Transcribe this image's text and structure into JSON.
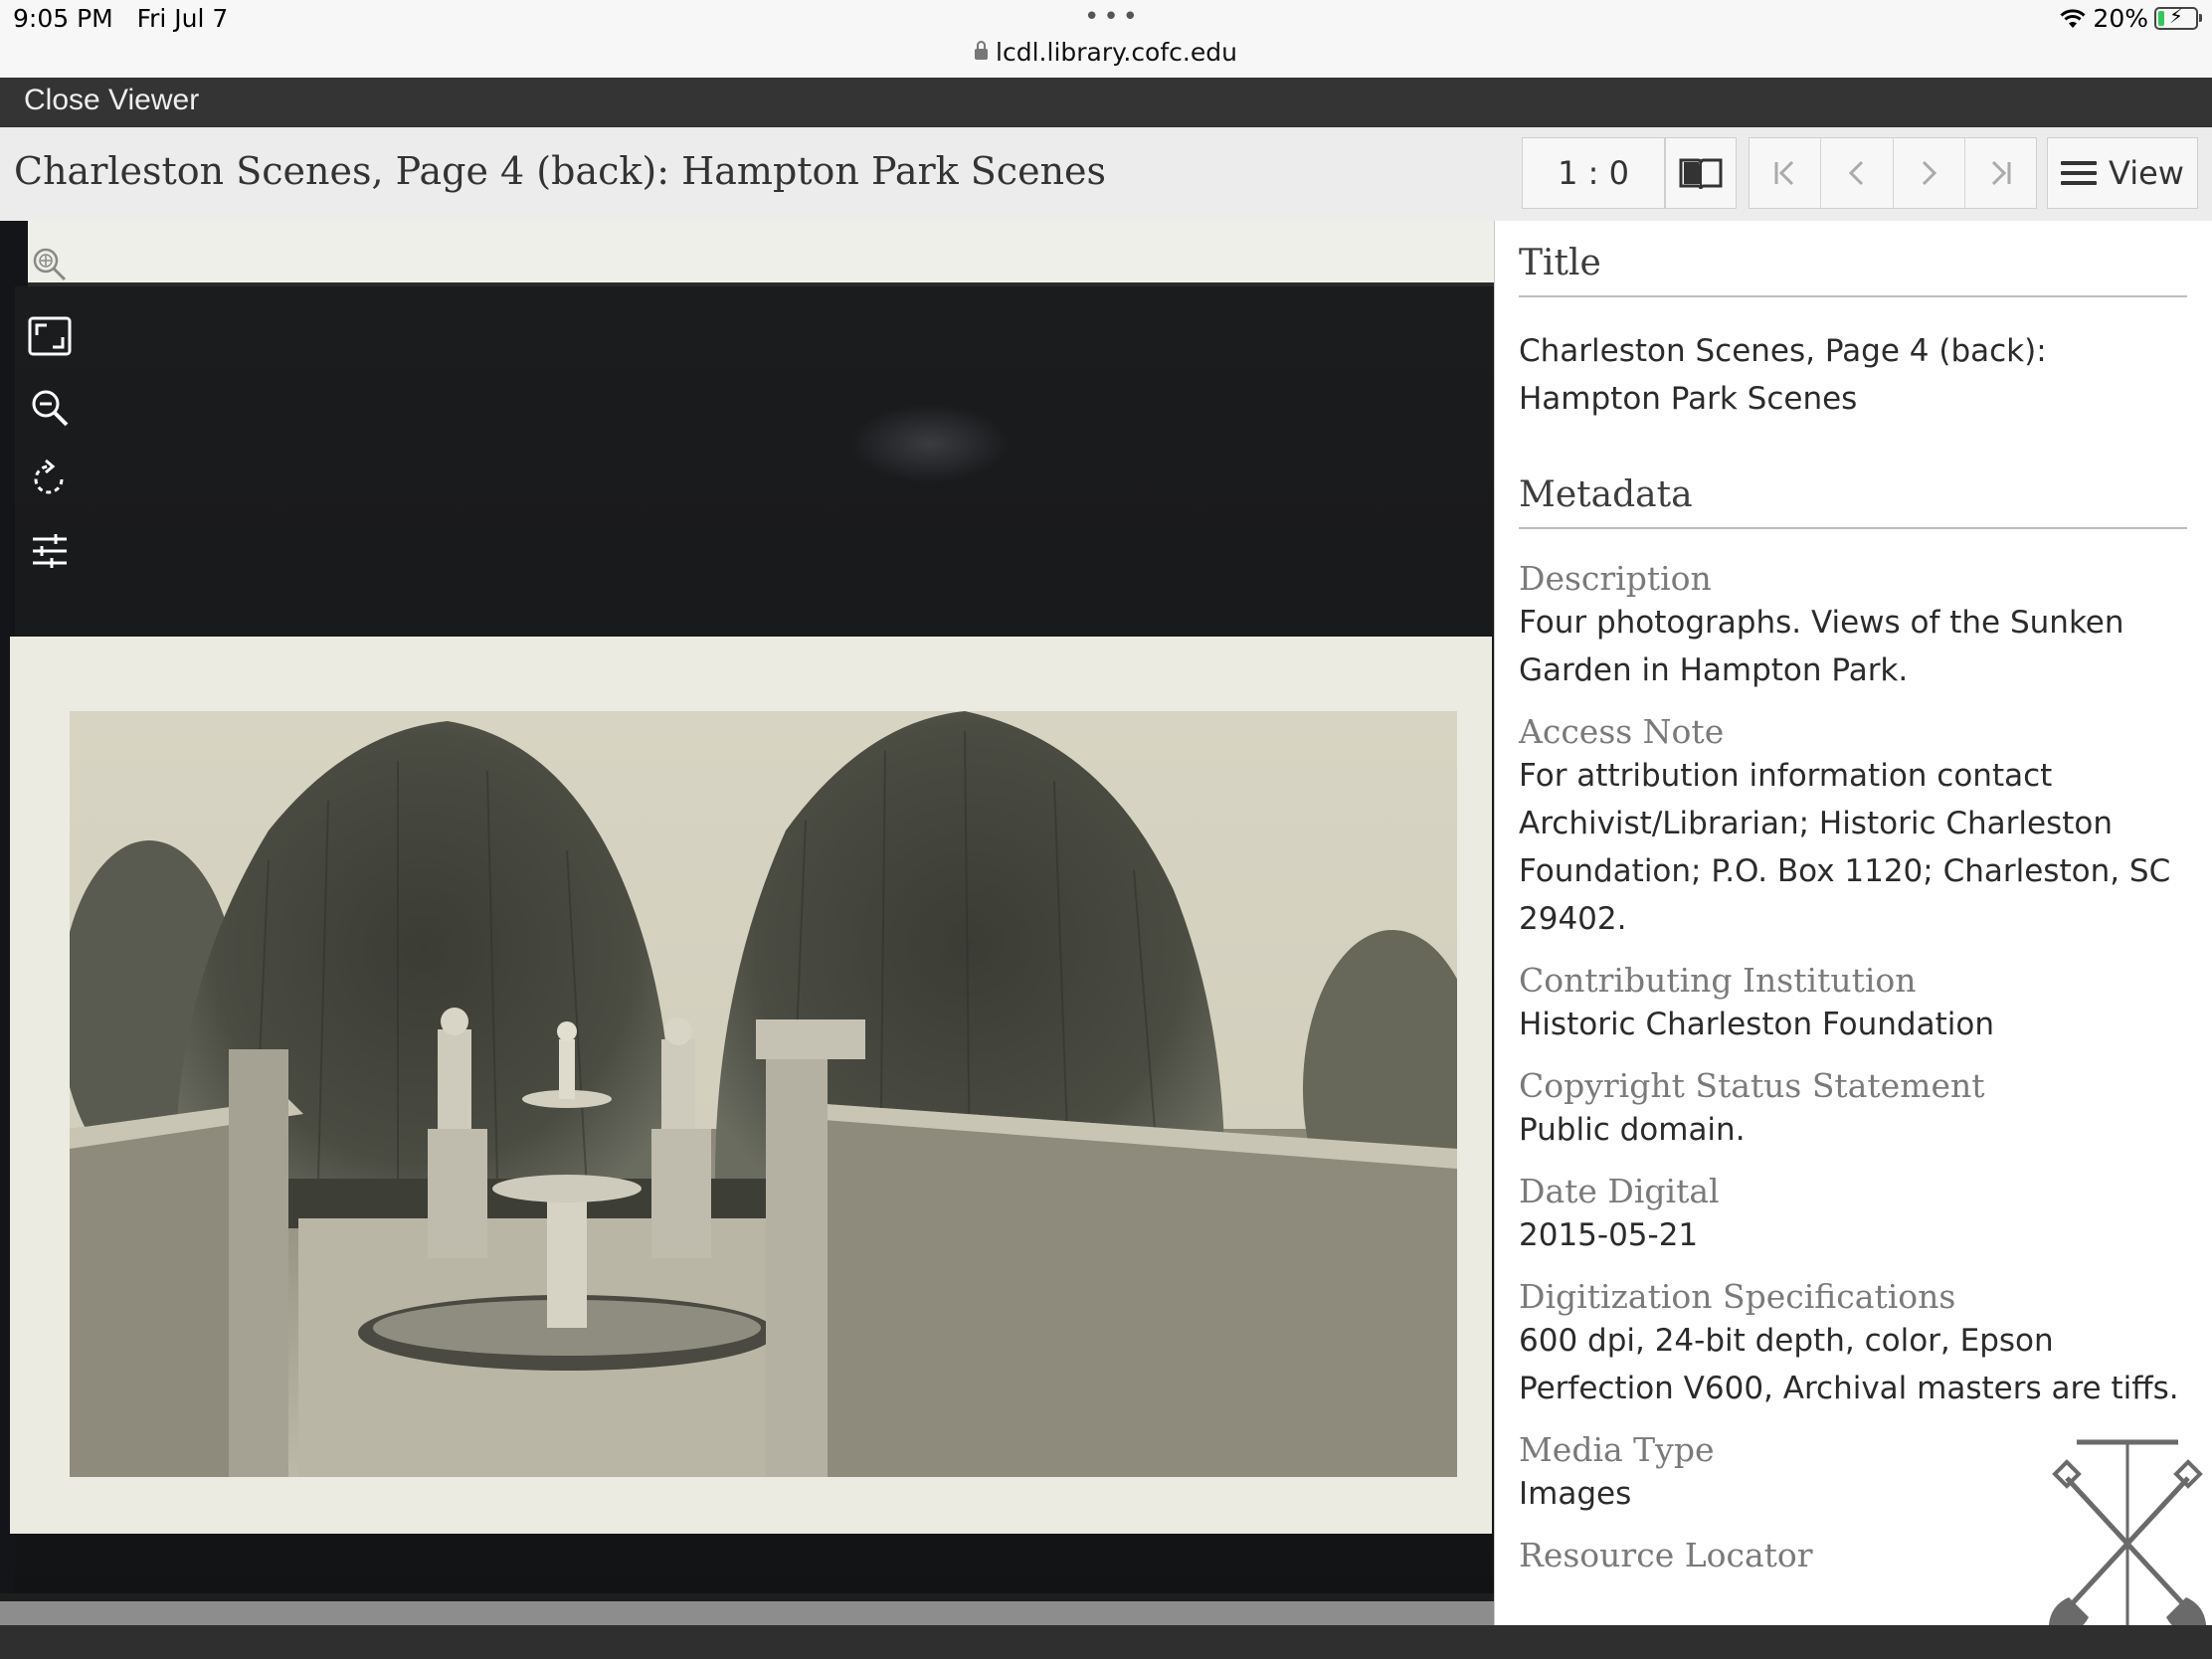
{
  "status_bar": {
    "time": "9:05 PM",
    "date": "Fri Jul 7",
    "url": "lcdl.library.cofc.edu",
    "battery": "20%",
    "battery_level": 0.2
  },
  "viewer_bar": {
    "close_label": "Close Viewer"
  },
  "header": {
    "title": "Charleston Scenes, Page 4 (back): Hampton Park Scenes",
    "page_indicator": "1 : 0",
    "view_label": "View"
  },
  "tools": [
    "zoom-in-icon",
    "fullscreen-icon",
    "zoom-out-icon",
    "rotate-icon",
    "adjust-icon"
  ],
  "panel": {
    "title_heading": "Title",
    "title_value": "Charleston Scenes, Page 4 (back): Hampton Park Scenes",
    "metadata_heading": "Metadata",
    "fields": [
      {
        "label": "Description",
        "value": "Four photographs. Views of the Sunken Garden in Hampton Park."
      },
      {
        "label": "Access Note",
        "value": "For attribution information contact Archivist/Librarian; Historic Charleston Foundation; P.O. Box 1120; Charleston, SC 29402."
      },
      {
        "label": "Contributing Institution",
        "value": "Historic Charleston Foundation"
      },
      {
        "label": "Copyright Status Statement",
        "value": "Public domain."
      },
      {
        "label": "Date Digital",
        "value": "2015-05-21"
      },
      {
        "label": "Digitization Specifications",
        "value": "600 dpi, 24-bit depth, color, Epson Perfection V600, Archival masters are tiffs."
      },
      {
        "label": "Media Type",
        "value": "Images"
      },
      {
        "label": "Resource Locator",
        "value": ""
      }
    ]
  },
  "colors": {
    "header_bg": "#ececec",
    "close_bar_bg": "#343434",
    "viewer_bg": "#141518",
    "label_gray": "#7a7a7a"
  }
}
